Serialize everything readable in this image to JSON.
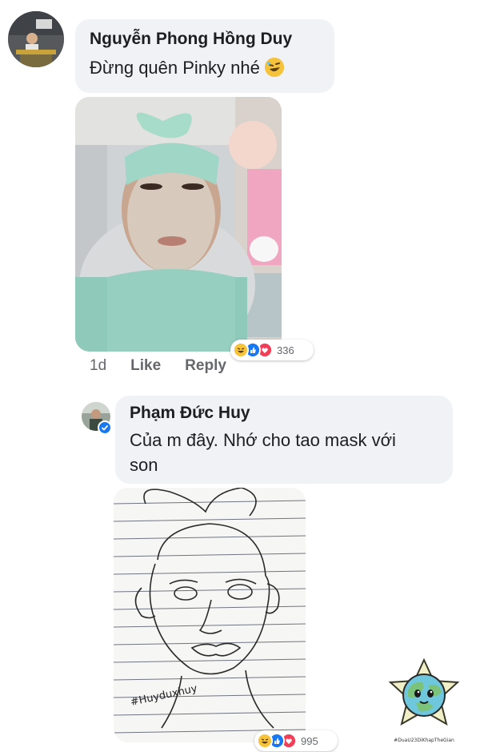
{
  "comments": [
    {
      "author": "Nguyễn Phong Hồng Duy",
      "text": "Đừng quên Pinky nhé",
      "emoji": "rofl-emoji",
      "reaction_count": "336",
      "time": "1d",
      "like_label": "Like",
      "reply_label": "Reply"
    },
    {
      "author": "Phạm Đức Huy",
      "text_line1": "Của m đây. Nhớ cho tao mask với",
      "text_line2": "son",
      "reaction_count": "995",
      "sketch_caption": "#Huyduxhuy"
    }
  ],
  "watermark": {
    "caption": "#DuaU23DiKhapTheGian"
  },
  "icons": [
    "haha-reaction-icon",
    "like-reaction-icon",
    "love-reaction-icon",
    "verified-badge-icon"
  ]
}
